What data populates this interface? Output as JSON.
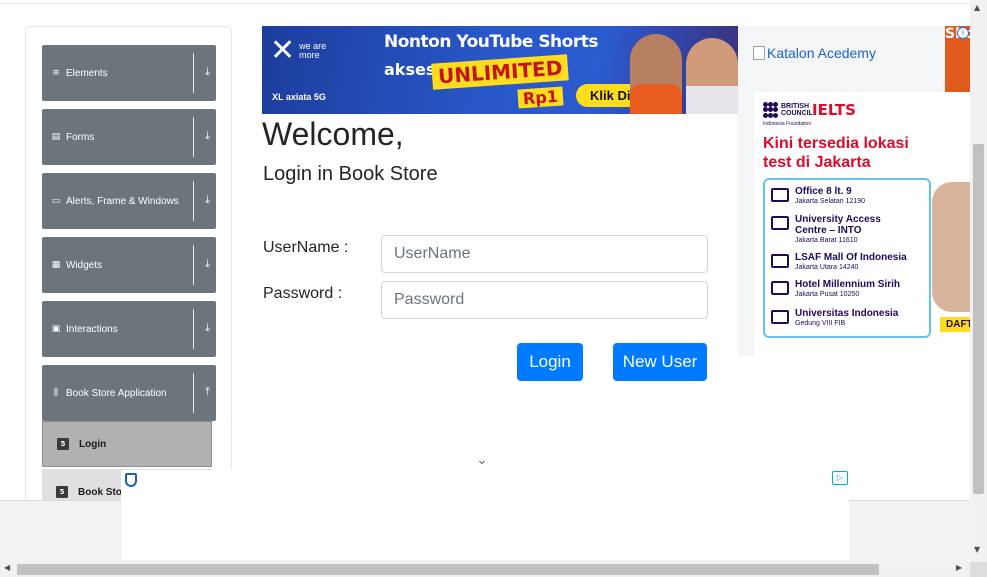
{
  "sidebar": {
    "groups": [
      {
        "label": "Elements",
        "icon": "list-icon",
        "glyph": "≡",
        "arrow": "⤓"
      },
      {
        "label": "Forms",
        "icon": "form-icon",
        "glyph": "▤",
        "arrow": "⤓"
      },
      {
        "label": "Alerts, Frame & Windows",
        "icon": "window-icon",
        "glyph": "▭",
        "arrow": "⤓"
      },
      {
        "label": "Widgets",
        "icon": "widgets-icon",
        "glyph": "▦",
        "arrow": "⤓"
      },
      {
        "label": "Interactions",
        "icon": "interactions-icon",
        "glyph": "▣",
        "arrow": "⤓"
      },
      {
        "label": "Book Store Application",
        "icon": "bookshelf-icon",
        "glyph": "⫼",
        "arrow": "⤒"
      }
    ],
    "items": [
      {
        "label": "Login",
        "icon": "html5-icon",
        "glyph": "5"
      },
      {
        "label": "Book Stor",
        "icon": "html5-icon",
        "glyph": "5"
      }
    ]
  },
  "banner": {
    "brand_we": "we are more",
    "headline": "Nonton YouTube Shorts",
    "akses": "akses",
    "unlimited": "UNLIMITED",
    "price": "Rp1",
    "cta": "Klik Di Sini",
    "operator": "XL axiata 5G"
  },
  "main": {
    "welcome": "Welcome,",
    "subtitle": "Login in Book Store",
    "username_label": "UserName :",
    "username_placeholder": "UserName",
    "password_label": "Password :",
    "password_placeholder": "Password",
    "login_button": "Login",
    "new_user_button": "New User",
    "chevron": "⌄"
  },
  "right_ad": {
    "image_alt": "Katalon Acedemy",
    "shorts_text": "Shor",
    "info": "i",
    "british_council": "BRITISH COUNCIL",
    "ielts": "IELTS",
    "foundation": "Indonesia Foundation",
    "tagline": "Kini tersedia lokasi test di Jakarta",
    "locations": [
      {
        "name": "Office 8 lt. 9",
        "area": "Jakarta Selatan 12190"
      },
      {
        "name": "University Access Centre – INTO",
        "area": "Jakarta Barat 11610"
      },
      {
        "name": "LSAF Mall Of Indonesia",
        "area": "Jakarta Utara 14240"
      },
      {
        "name": "Hotel Millennium Sirih",
        "area": "Jakarta Pusat 10250"
      },
      {
        "name": "Universitas Indonesia",
        "area": "Gedung VIII FIB"
      }
    ],
    "daftar": "DAFTAR"
  },
  "bottom_ad": {
    "adchoices": "▷"
  },
  "scrollbars": {
    "up": "▲",
    "down": "▼",
    "left": "◀",
    "right": "▶"
  },
  "colors": {
    "primary_button": "#007bff",
    "sidebar_header": "#6c747c",
    "ielts_red": "#e3092d"
  }
}
